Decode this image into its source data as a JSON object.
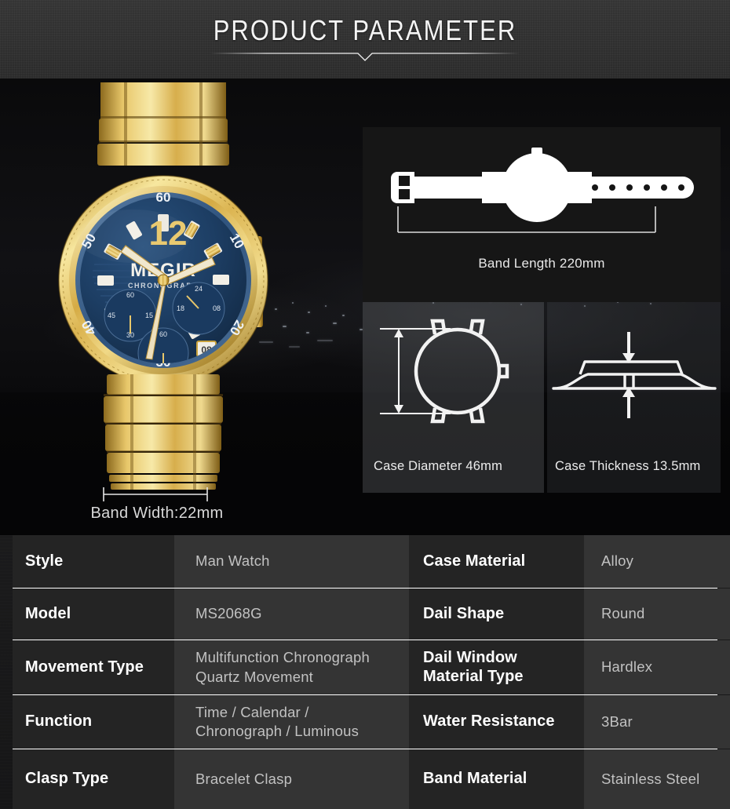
{
  "header": {
    "title": "PRODUCT PARAMETER",
    "divider_icon": "chevron-down-rule"
  },
  "hero": {
    "product_image_alt": "gold-chronograph-wristwatch",
    "watch": {
      "brand": "MEGIR",
      "brand_sub": "CHRONOGRAPH",
      "hour_marker": "12",
      "bezel_numerals": [
        "60",
        "10",
        "20",
        "30",
        "40",
        "50"
      ],
      "subdial_left": {
        "top": "60",
        "left": "45",
        "right": "15",
        "bottom": "30"
      },
      "subdial_right": {
        "top": "24",
        "left": "18",
        "right": "08"
      },
      "subdial_bottom": {
        "top": "60",
        "bottom": "30"
      },
      "date": "08",
      "case_color": "#e3be5c",
      "dial_color": "#1b3a5e"
    },
    "band_width_label": "Band Width:22mm"
  },
  "diagrams": [
    {
      "id": "band-length",
      "icon": "wristwatch-side-silhouette",
      "caption": "Band Length 220mm",
      "measure": "bracket-horizontal",
      "strap_holes": 6
    },
    {
      "id": "case-diameter",
      "icon": "watch-case-front-outline",
      "caption": "Case Diameter 46mm",
      "measure": "arrow-vertical-double"
    },
    {
      "id": "case-thickness",
      "icon": "watch-case-profile-outline",
      "caption": "Case Thickness 13.5mm",
      "measure": "arrows-inward-vertical"
    }
  ],
  "spec_table": {
    "rows": [
      {
        "label1": "Style",
        "value1": "Man Watch",
        "label2": "Case Material",
        "value2": "Alloy"
      },
      {
        "label1": "Model",
        "value1": "MS2068G",
        "label2": "Dail Shape",
        "value2": "Round"
      },
      {
        "label1": "Movement Type",
        "value1": "Multifunction Chronograph\nQuartz Movement",
        "label2": "Dail Window\nMaterial Type",
        "value2": "Hardlex"
      },
      {
        "label1": "Function",
        "value1": "Time  / Calendar /\nChronograph / Luminous",
        "label2": "Water Resistance",
        "value2": "3Bar"
      },
      {
        "label1": "Clasp Type",
        "value1": "Bracelet Clasp",
        "label2": "Band Material",
        "value2": "Stainless Steel"
      }
    ]
  },
  "colors": {
    "header_bg": "#303030",
    "label_cell_bg": "#242424",
    "value_cell_bg": "#343434",
    "divider": "#ffffff",
    "label_text": "#ffffff",
    "value_text": "#c2c2c2",
    "gold": "#e3be5c",
    "dial_blue": "#1b3a5e"
  }
}
